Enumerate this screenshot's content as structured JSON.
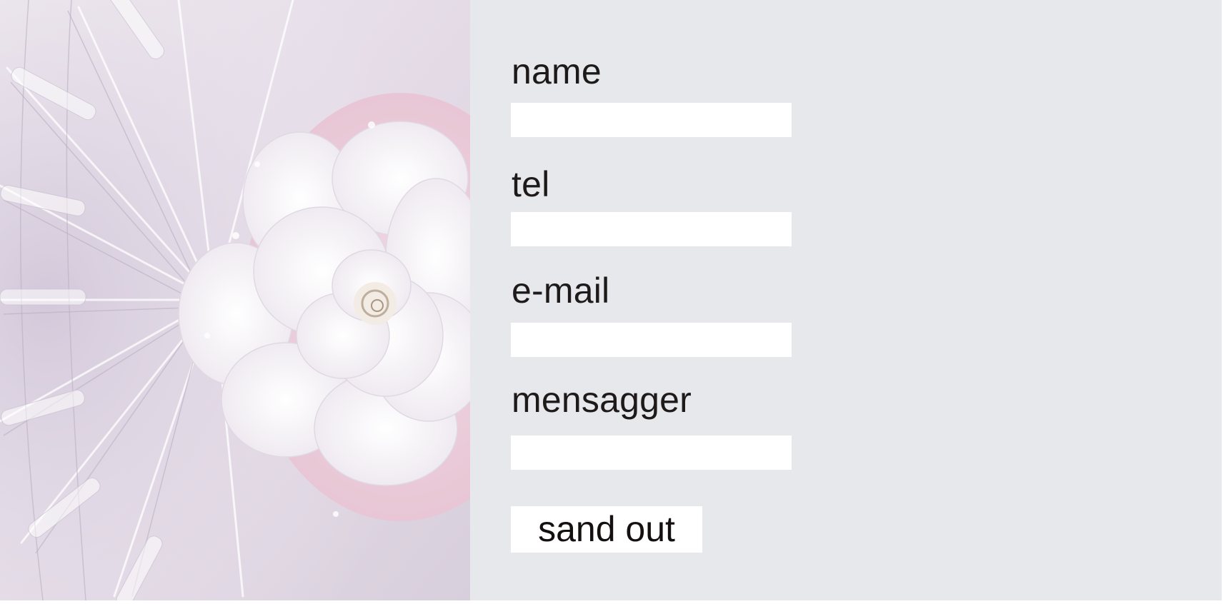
{
  "form": {
    "fields": [
      {
        "label": "name",
        "value": ""
      },
      {
        "label": "tel",
        "value": ""
      },
      {
        "label": "e-mail",
        "value": ""
      },
      {
        "label": "mensagger",
        "value": ""
      }
    ],
    "submit_label": "sand out"
  },
  "colors": {
    "panel_background": "#e7e8ec",
    "field_background": "#ffffff",
    "text": "#1e1a1a"
  },
  "hero": {
    "icon": "white-flower-photo"
  }
}
